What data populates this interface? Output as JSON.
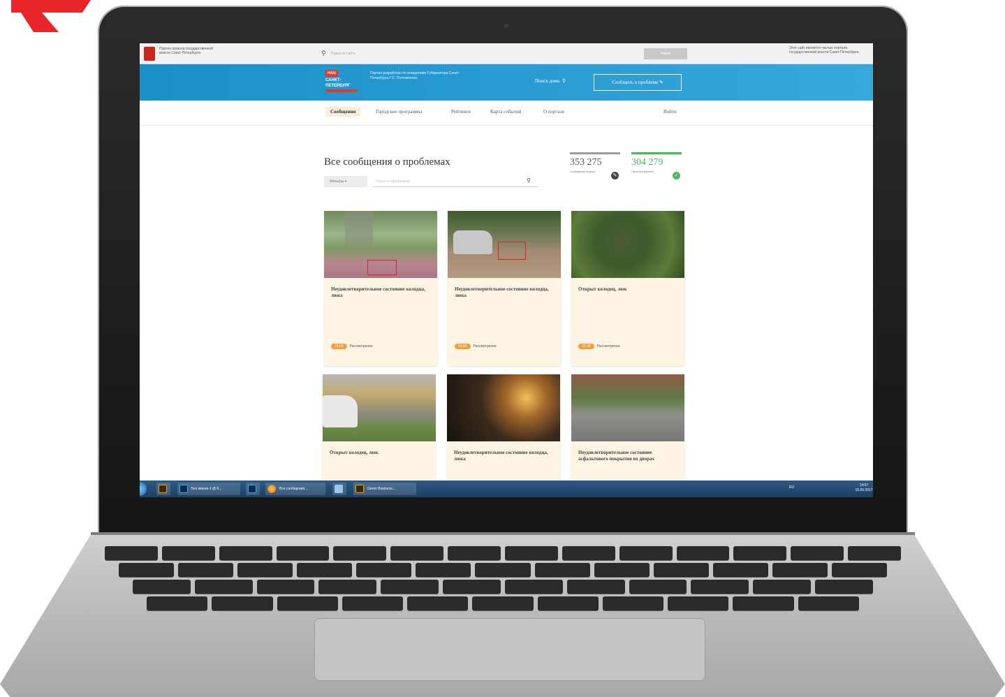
{
  "gov_bar": {
    "left_text": "Портал органов государственной власти Санкт-Петербурга",
    "search_placeholder": "Поиск по сайту",
    "search_button": "Найти",
    "right_text": "Этот сайт является частью портала государственной власти Санкт-Петербурга"
  },
  "header": {
    "logo_badge": "НАШ",
    "logo_line1": "САНКТ-",
    "logo_line2": "ПЕТЕРБУРГ",
    "tagline": "Портал разработан по инициативе Губернатора Санкт-Петербурга Г.С. Полтавченко",
    "search_label": "Поиск дома",
    "report_button": "Сообщить о проблеме"
  },
  "nav": {
    "items": [
      "Сообщения",
      "Городские программы",
      "Рейтинги",
      "Карта событий",
      "О портале"
    ],
    "active_index": 0,
    "login": "Войти"
  },
  "main": {
    "title": "Все сообщения о проблемах",
    "filter_button": "Фильтры",
    "search_placeholder": "Поиск по проблемам"
  },
  "stats": [
    {
      "value": "353 275",
      "label": "Сообщений подано",
      "color": "#9b9b9b"
    },
    {
      "value": "304 279",
      "label": "Проблем решено",
      "color": "#4cb857"
    }
  ],
  "cards": [
    {
      "title": "Неудовлетворительное состояние колодца, люка",
      "date": "15.06",
      "status": "Рассмотрение"
    },
    {
      "title": "Неудовлетворительное состояние колодца, люка",
      "date": "15.06",
      "status": "Рассмотрение"
    },
    {
      "title": "Открыт колодец, люк",
      "date": "15.06",
      "status": "Рассмотрение"
    },
    {
      "title": "Открыт колодец, люк",
      "date": "",
      "status": ""
    },
    {
      "title": "Неудовлетворительное состояние колодца, люка",
      "date": "",
      "status": ""
    },
    {
      "title": "Неудовлетворительное состояние асфальтового покрытия во дворах",
      "date": "",
      "status": ""
    }
  ],
  "taskbar": {
    "items": [
      "",
      "Без имени-1 @ 6...",
      "",
      "Все сообщения...",
      "",
      "Green Business..."
    ],
    "tray": "RU",
    "time": "14:07",
    "date": "15.06.2017"
  },
  "colors": {
    "accent_blue": "#1c8fc9",
    "brand_red": "#e03a2b",
    "card_bg": "#fdf4e4",
    "date_badge": "#f59c3d",
    "solved_green": "#4cb857"
  }
}
